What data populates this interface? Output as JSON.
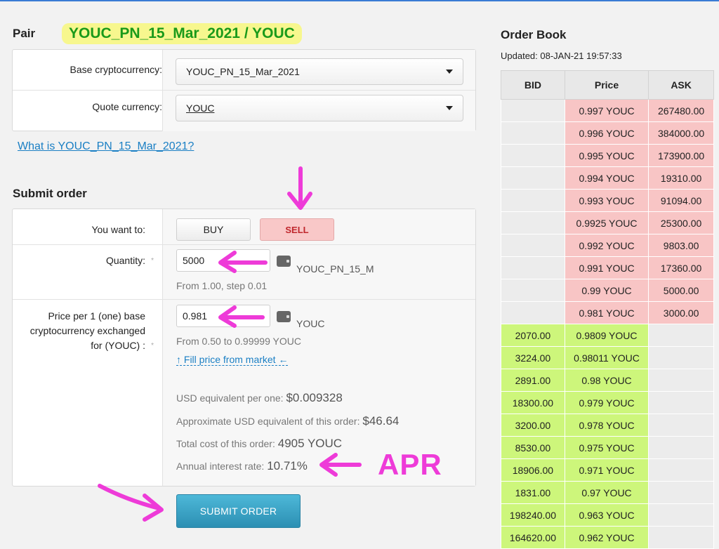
{
  "pair": {
    "label": "Pair",
    "title": "YOUC_PN_15_Mar_2021 / YOUC",
    "base_label": "Base cryptocurrency:",
    "base_value": "YOUC_PN_15_Mar_2021",
    "quote_label": "Quote currency:",
    "quote_value": "YOUC",
    "what_link": "What is YOUC_PN_15_Mar_2021?"
  },
  "order": {
    "title": "Submit order",
    "want_label": "You want to:",
    "buy_label": "BUY",
    "sell_label": "SELL",
    "quantity_label": "Quantity:",
    "quantity_value": "5000",
    "quantity_unit": "YOUC_PN_15_M",
    "quantity_hint": "From 1.00, step 0.01",
    "price_label_1": "Price per 1 (one) base",
    "price_label_2": "cryptocurrency exchanged",
    "price_label_3": "for (YOUC) :",
    "price_value": "0.981",
    "price_unit": "YOUC",
    "price_hint": "From 0.50 to 0.99999 YOUC",
    "fill_link": "↑ Fill price from market ←",
    "usd_per_one_label": "USD equivalent per one:",
    "usd_per_one_value": "$0.009328",
    "usd_order_label": "Approximate USD equivalent of this order:",
    "usd_order_value": "$46.64",
    "total_label": "Total cost of this order:",
    "total_value": "4905 YOUC",
    "apr_label": "Annual interest rate:",
    "apr_value": "10.71%",
    "submit_label": "SUBMIT ORDER",
    "required_star": "*"
  },
  "annotation": {
    "apr_text": "APR",
    "arrow_color": "#ee3bd8"
  },
  "order_book": {
    "title": "Order Book",
    "updated": "Updated: 08-JAN-21 19:57:33",
    "headers": [
      "BID",
      "Price",
      "ASK"
    ],
    "asks": [
      {
        "price": "0.997 YOUC",
        "ask": "267480.00"
      },
      {
        "price": "0.996 YOUC",
        "ask": "384000.00"
      },
      {
        "price": "0.995 YOUC",
        "ask": "173900.00"
      },
      {
        "price": "0.994 YOUC",
        "ask": "19310.00"
      },
      {
        "price": "0.993 YOUC",
        "ask": "91094.00"
      },
      {
        "price": "0.9925 YOUC",
        "ask": "25300.00"
      },
      {
        "price": "0.992 YOUC",
        "ask": "9803.00"
      },
      {
        "price": "0.991 YOUC",
        "ask": "17360.00"
      },
      {
        "price": "0.99 YOUC",
        "ask": "5000.00"
      },
      {
        "price": "0.981 YOUC",
        "ask": "3000.00"
      }
    ],
    "bids": [
      {
        "bid": "2070.00",
        "price": "0.9809 YOUC"
      },
      {
        "bid": "3224.00",
        "price": "0.98011 YOUC"
      },
      {
        "bid": "2891.00",
        "price": "0.98 YOUC"
      },
      {
        "bid": "18300.00",
        "price": "0.979 YOUC"
      },
      {
        "bid": "3200.00",
        "price": "0.978 YOUC"
      },
      {
        "bid": "8530.00",
        "price": "0.975 YOUC"
      },
      {
        "bid": "18906.00",
        "price": "0.971 YOUC"
      },
      {
        "bid": "1831.00",
        "price": "0.97 YOUC"
      },
      {
        "bid": "198240.00",
        "price": "0.963 YOUC"
      },
      {
        "bid": "164620.00",
        "price": "0.962 YOUC"
      }
    ],
    "ask_color": "#f8c5c5",
    "bid_color": "#cdf67b"
  }
}
